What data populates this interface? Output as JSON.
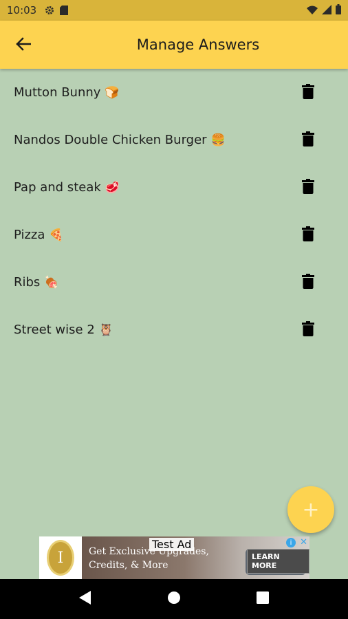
{
  "status_bar": {
    "time": "10:03",
    "icons": [
      "settings-gear-icon",
      "sd-card-icon",
      "wifi-icon",
      "signal-icon",
      "battery-icon"
    ]
  },
  "app_bar": {
    "title": "Manage Answers",
    "back_icon": "arrow-back-icon",
    "color": "#fdd350"
  },
  "answers": [
    {
      "label": "Mutton Bunny",
      "emoji": "🍞"
    },
    {
      "label": "Nandos Double Chicken Burger",
      "emoji": "🍔"
    },
    {
      "label": "Pap and steak",
      "emoji": "🥩"
    },
    {
      "label": "Pizza",
      "emoji": "🍕"
    },
    {
      "label": "Ribs",
      "emoji": "🍖"
    },
    {
      "label": "Street wise 2",
      "emoji": "🦉"
    }
  ],
  "fab": {
    "label": "+",
    "icon": "add-icon"
  },
  "ad": {
    "badge": "Test Ad",
    "headline": "Get Exclusive Upgrades,",
    "subline": "Credits, & More",
    "cta": "LEARN MORE",
    "info_icon": "i",
    "close_icon": "✕",
    "logo_glyph": "I"
  },
  "nav_bar": {
    "buttons": [
      "back-triangle-icon",
      "home-circle-icon",
      "recents-square-icon"
    ]
  },
  "colors": {
    "background": "#b8d0b4",
    "accent": "#fdd350",
    "status_bar": "#d9b43a"
  }
}
